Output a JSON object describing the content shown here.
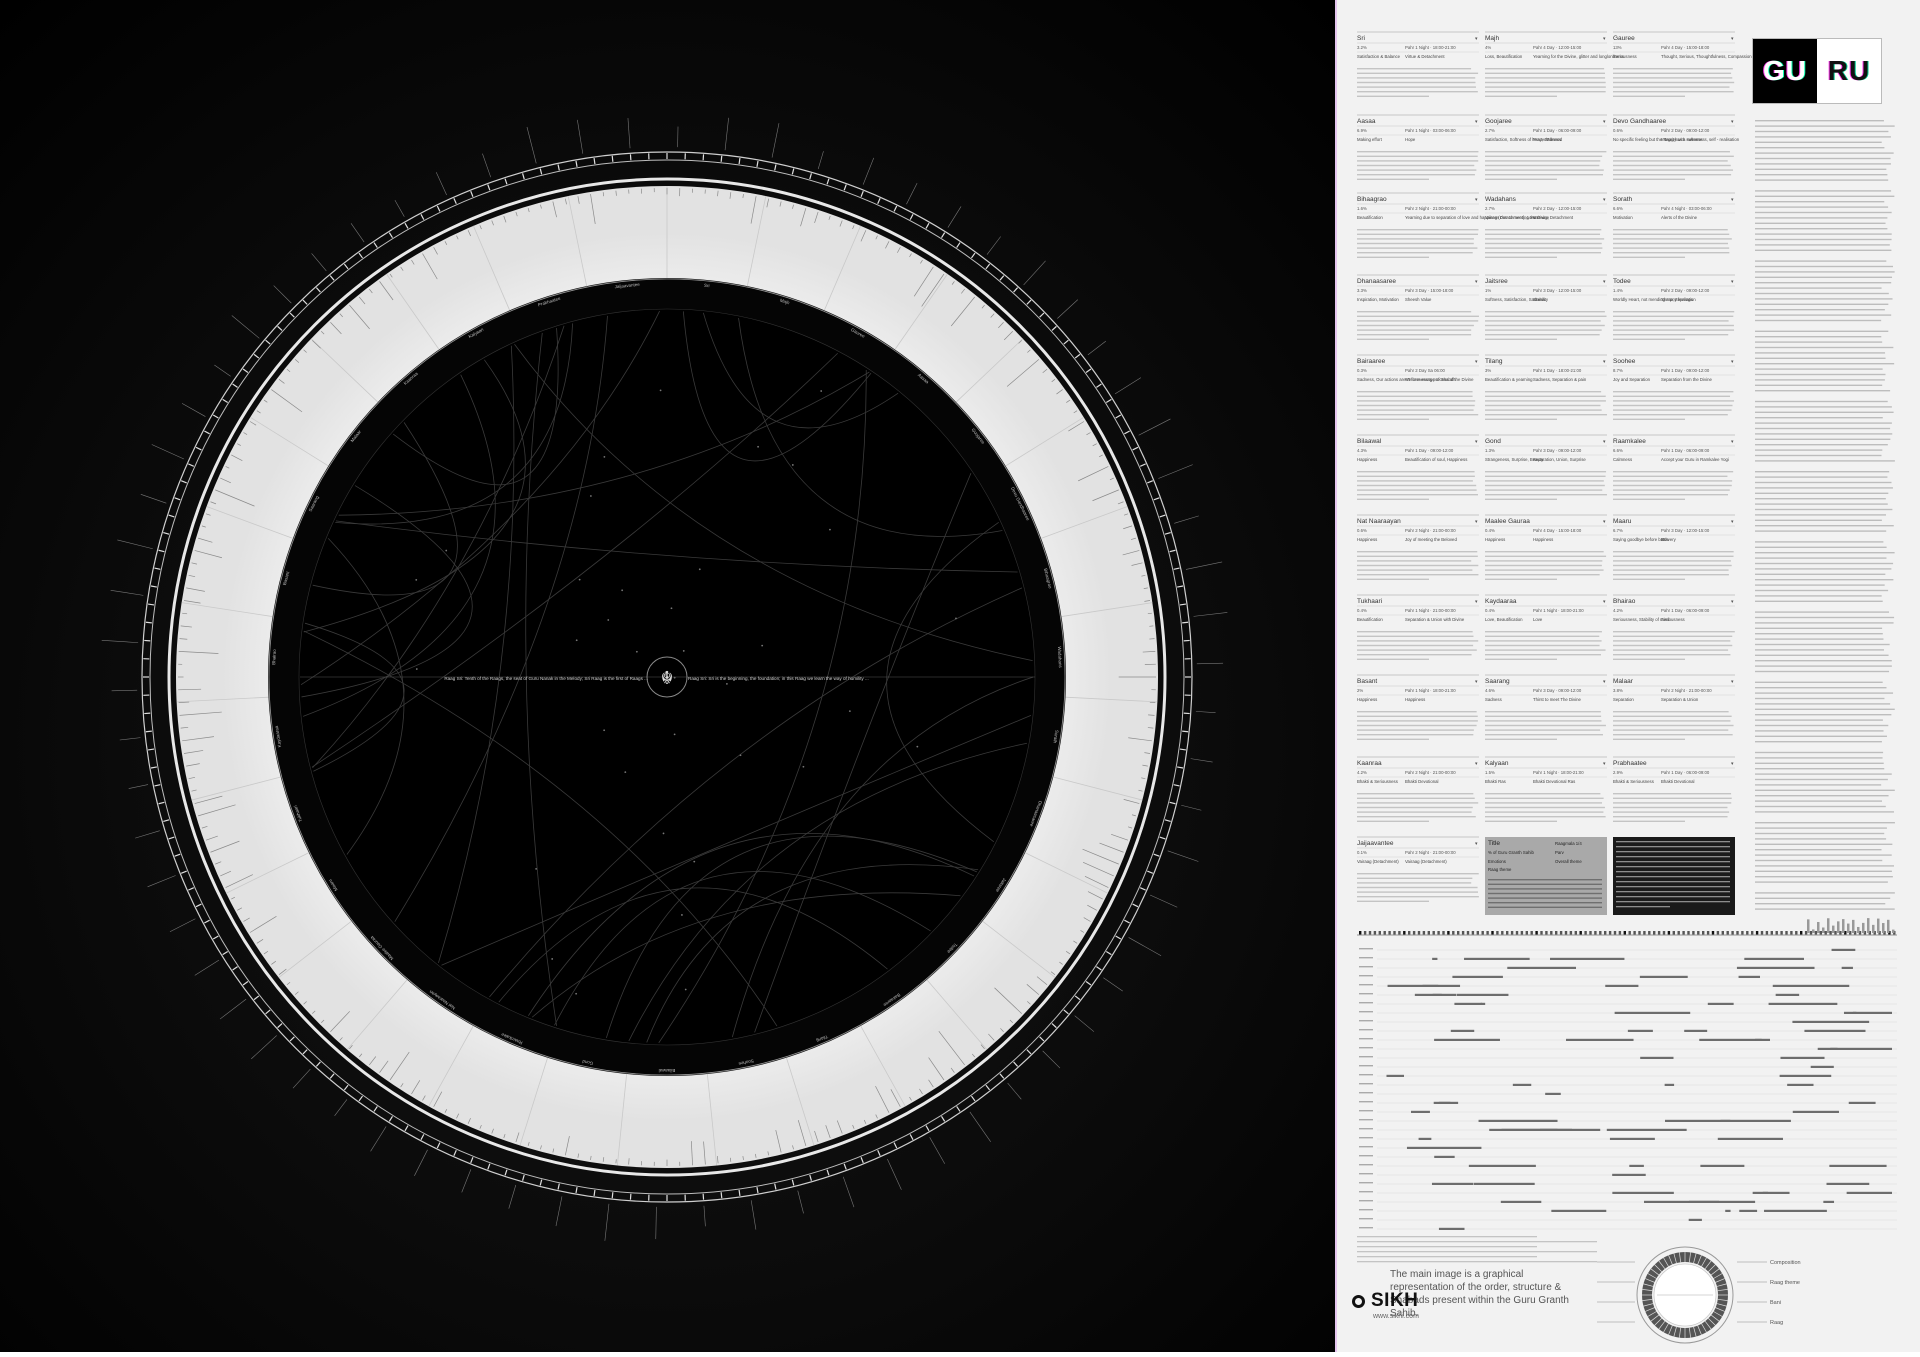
{
  "header": {
    "logo_left": "GU",
    "logo_right": "RU"
  },
  "center": {
    "caption_left": "Raag Sri: Tenth of the Raags, the seat of Guru Nanak in the Melody; Sri Raag is the first of Raags ...",
    "caption_right": "Raag Sri: Sri is the beginning, the foundation; in this Raag we learn the way of humility ..."
  },
  "raag_cards": [
    {
      "name": "Sri",
      "pct": "3.2%",
      "time": "Pahr 1 Night · 18:00-21:00",
      "c1": "Satisfaction & Balance",
      "c2": "Virtue & Detachment"
    },
    {
      "name": "Majh",
      "pct": "4%",
      "time": "Pahr 4 Day · 12:00-15:00",
      "c1": "Loss, Beautification",
      "c2": "Yearning for the Divine, glitter and longlonliness",
      "c3": ""
    },
    {
      "name": "Gauree",
      "pct": "13%",
      "time": "Pahr 4 Day · 15:00-18:00",
      "c1": "Seriousness",
      "c2": "Thought, Serious, Thoughtfulness, Compassion"
    },
    {
      "name": "Aasaa",
      "pct": "6.9%",
      "time": "Pahr 1 Night · 03:00-06:00",
      "c1": "Making effort",
      "c2": "Hope"
    },
    {
      "name": "Goojaree",
      "pct": "2.7%",
      "time": "Pahr 1 Day · 06:00-09:00",
      "c1": "Satisfaction, Softness of heart, Sadness",
      "c2": "Prayer/Blessed"
    },
    {
      "name": "Devo Gandhaaree",
      "pct": "0.6%",
      "time": "Pahr 2 Day · 09:00-12:00",
      "c1": "No specific feeling but the Raag has a softness",
      "c2": "Integrity with sweetness, self - realisation"
    },
    {
      "name": "Bihaagrao",
      "pct": "1.6%",
      "time": "Pahr 2 Night · 21:00-00:00",
      "c1": "Beautification",
      "c2": "Yearning due to separation of love and happiness due to meeting the Divine"
    },
    {
      "name": "Wadahans",
      "pct": "2.7%",
      "time": "Pahr 2 Day · 12:00-15:00",
      "c1": "Vairag (Detachment), Loss",
      "c2": "Vairaag, Detachment"
    },
    {
      "name": "Sorath",
      "pct": "6.6%",
      "time": "Pahr 4 Night · 03:00-06:00",
      "c1": "Motivation",
      "c2": "Alerts of the Divine"
    },
    {
      "name": "Dhanaasaree",
      "pct": "3.3%",
      "time": "Pahr 3 Day · 15:00-18:00",
      "c1": "Inspiration, Motivation",
      "c2": "Sheesh Value"
    },
    {
      "name": "Jaitsree",
      "pct": "1%",
      "time": "Pahr 3 Day · 12:00-15:00",
      "c1": "Softness, Satisfaction, Sadness",
      "c2": "Stability"
    },
    {
      "name": "Todee",
      "pct": "1.4%",
      "time": "Pahr 2 Day · 09:00-12:00",
      "c1": "Worldly Heart, not mending many feelings",
      "c2": "Sharp, Separation"
    },
    {
      "name": "Bairaaree",
      "pct": "0.3%",
      "time": "Pahr 2 Day Sa 06:00",
      "c1": "Sadness, Our actions aren't for message of Shabdh",
      "c2": "We lose every process of the Divine"
    },
    {
      "name": "Tilang",
      "pct": "3%",
      "time": "Pahr 1 Day · 18:00-21:00",
      "c1": "Beautification & yearning",
      "c2": "Sadness, Separation & pain"
    },
    {
      "name": "Soohee",
      "pct": "8.7%",
      "time": "Pahr 1 Day · 09:00-12:00",
      "c1": "Joy and Separation",
      "c2": "Separation from the Divine"
    },
    {
      "name": "Bilaawal",
      "pct": "4.3%",
      "time": "Pahr 1 Day · 09:00-12:00",
      "c1": "Happiness",
      "c2": "Beautification of soul, Happiness"
    },
    {
      "name": "Gond",
      "pct": "1.3%",
      "time": "Pahr 3 Day · 09:00-12:00",
      "c1": "Strangeness, Surprise, Beauty",
      "c2": "Separation, Union, Surprise"
    },
    {
      "name": "Raamkalee",
      "pct": "6.6%",
      "time": "Pahr 1 Day · 06:00-09:00",
      "c1": "Calmness",
      "c2": "Accept your Guru in Ramkalee Yogi"
    },
    {
      "name": "Nat Naaraayan",
      "pct": "0.6%",
      "time": "Pahr 2 Night · 21:00-00:00",
      "c1": "Happiness",
      "c2": "Joy of meeting the Beloved"
    },
    {
      "name": "Maalee Gauraa",
      "pct": "0.4%",
      "time": "Pahr 4 Day · 15:00-18:00",
      "c1": "Happiness",
      "c2": "Happiness"
    },
    {
      "name": "Maaru",
      "pct": "6.7%",
      "time": "Pahr 3 Day · 12:00-15:00",
      "c1": "Saying goodbye before battle",
      "c2": "Bravery"
    },
    {
      "name": "Tukhaari",
      "pct": "0.4%",
      "time": "Pahr 1 Night · 21:00-00:00",
      "c1": "Beautification",
      "c2": "Separation & Union with Divine"
    },
    {
      "name": "Kaydaaraa",
      "pct": "0.4%",
      "time": "Pahr 1 Night · 18:00-21:00",
      "c1": "Love, Beautification",
      "c2": "Love"
    },
    {
      "name": "Bhairao",
      "pct": "4.2%",
      "time": "Pahr 1 Day · 06:00-09:00",
      "c1": "Seriousness, Stability of mind",
      "c2": "Seriousness"
    },
    {
      "name": "Basant",
      "pct": "2%",
      "time": "Pahr 1 Night · 18:00-21:00",
      "c1": "Happiness",
      "c2": "Happiness"
    },
    {
      "name": "Saarang",
      "pct": "4.6%",
      "time": "Pahr 3 Day · 09:00-12:00",
      "c1": "Sadness",
      "c2": "Thirst to meet The Divine"
    },
    {
      "name": "Malaar",
      "pct": "3.8%",
      "time": "Pahr 2 Night · 21:00-00:00",
      "c1": "Separation",
      "c2": "Separation & Union"
    },
    {
      "name": "Kaanraa",
      "pct": "4.2%",
      "time": "Pahr 2 Night · 21:00-00:00",
      "c1": "Bhakti & Seriousness",
      "c2": "Bhakti Devotional"
    },
    {
      "name": "Kalyaan",
      "pct": "1.5%",
      "time": "Pahr 1 Night · 18:00-21:00",
      "c1": "Bhakti Ras",
      "c2": "Bhakti Devotional Ras"
    },
    {
      "name": "Prabhaatee",
      "pct": "2.9%",
      "time": "Pahr 1 Day · 06:00-09:00",
      "c1": "Bhakti & Seriousness",
      "c2": "Bhakti Devotional"
    },
    {
      "name": "Jaijaavantee",
      "pct": "0.1%",
      "time": "Pahr 2 Night · 21:00-00:00",
      "c1": "Vairaag (Detachment)",
      "c2": "Vairaag (Detachment)"
    }
  ],
  "key_card": {
    "name": "Title",
    "pct": "% of Guru Granth Sahib",
    "time": "Raagmala 1/4",
    "c1": "Emotions",
    "c2": "Parv",
    "c3": "Raag theme",
    "c4": "Overall theme"
  },
  "footer": {
    "blurb": "The main image is a graphical representation of the order, structure & Shabads present within the Guru Granth Sahib.",
    "brand": "SIKH",
    "url": "www.sikhi.com"
  },
  "legend": {
    "labels": [
      "Composition",
      "Raag theme",
      "Bani",
      "Raag"
    ]
  }
}
